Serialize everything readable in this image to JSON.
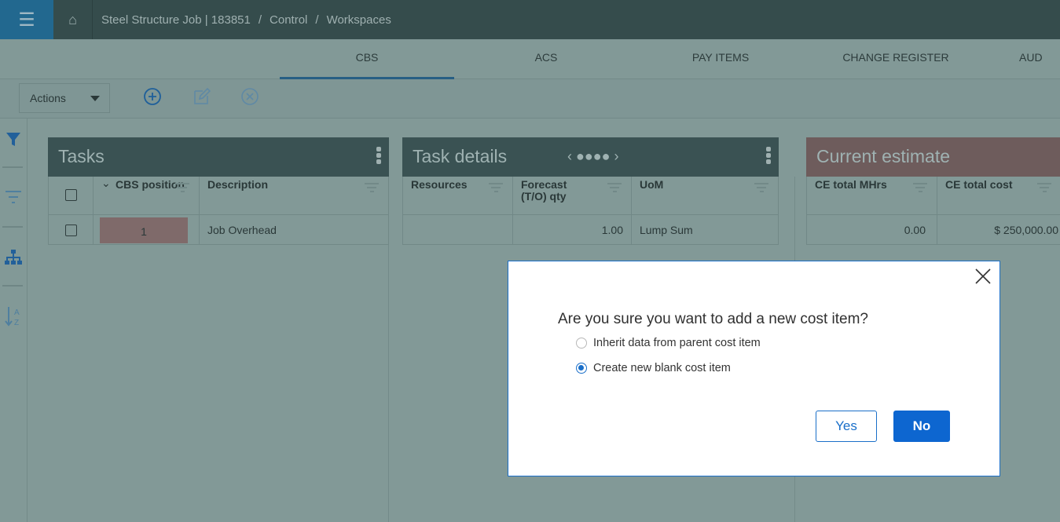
{
  "topbar": {
    "breadcrumb": [
      "Steel Structure Job | 183851",
      "/",
      "Control",
      "/",
      "Workspaces"
    ]
  },
  "tabs": [
    "CBS",
    "ACS",
    "PAY ITEMS",
    "CHANGE REGISTER",
    "AUD"
  ],
  "toolbar": {
    "actions_label": "Actions"
  },
  "tasks": {
    "title": "Tasks",
    "headers": [
      "CBS position",
      "Description"
    ],
    "row": {
      "position": "1",
      "description": "Job Overhead"
    }
  },
  "task_details": {
    "title": "Task details",
    "pager": "‹ ●●●● ›",
    "headers": [
      "Resources",
      "Forecast (T/O) qty",
      "UoM"
    ],
    "row": {
      "resources": "",
      "qty": "1.00",
      "uom": "Lump Sum"
    }
  },
  "current_estimate": {
    "title": "Current estimate",
    "headers": [
      "CE total MHrs",
      "CE total cost"
    ],
    "row": {
      "mhrs": "0.00",
      "cost": "$ 250,000.00"
    }
  },
  "dialog": {
    "question": "Are you sure you want to add a new cost item?",
    "options": [
      "Inherit data from parent cost item",
      "Create new blank cost item"
    ],
    "selected": 1,
    "yes": "Yes",
    "no": "No"
  }
}
